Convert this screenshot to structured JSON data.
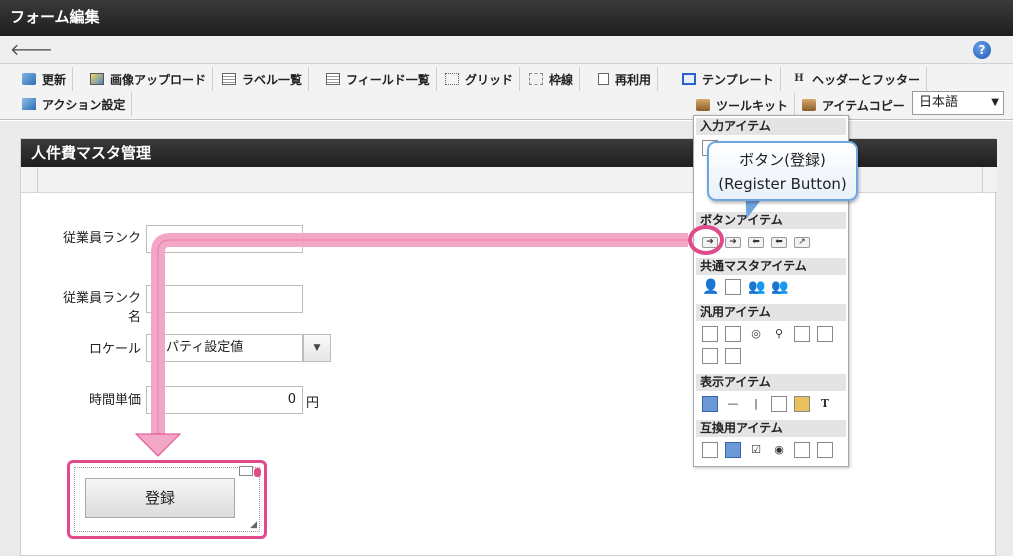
{
  "window": {
    "title": "フォーム編集"
  },
  "toolbar": {
    "row1": [
      {
        "label": "更新",
        "icon": "refresh-icon"
      },
      {
        "label": "画像アップロード",
        "icon": "image-upload-icon"
      },
      {
        "label": "ラベル一覧",
        "icon": "label-list-icon"
      },
      {
        "label": "フィールド一覧",
        "icon": "field-list-icon"
      },
      {
        "label": "グリッド",
        "icon": "grid-icon"
      },
      {
        "label": "枠線",
        "icon": "border-icon"
      },
      {
        "label": "再利用",
        "icon": "reuse-icon"
      },
      {
        "label": "テンプレート",
        "icon": "template-icon"
      },
      {
        "label": "ヘッダーとフッター",
        "icon": "header-footer-icon"
      }
    ],
    "action_label": "アクション設定",
    "toolkit_label": "ツールキット",
    "item_copy_label": "アイテムコピー",
    "language": "日本語"
  },
  "form": {
    "title": "人件費マスタ管理",
    "fields": {
      "rank_label": "従業員ランク",
      "rank_name_label": "従業員ランク名",
      "locale_label": "ロケール",
      "locale_value": "ロパティ設定値",
      "hourly_label": "時間単価",
      "hourly_value": "0",
      "hourly_unit": "円"
    },
    "register_button": "登録"
  },
  "palette": {
    "sections": {
      "input": "入力アイテム",
      "button": "ボタンアイテム",
      "common_master": "共通マスタアイテム",
      "general": "汎用アイテム",
      "display": "表示アイテム",
      "compat": "互換用アイテム"
    }
  },
  "callout": {
    "line1": "ボタン(登録)",
    "line2": "(Register Button)"
  },
  "colors": {
    "accent_pink": "#e2498a",
    "callout_border": "#6ea5e0",
    "header_dark": "#2a2a2a"
  }
}
